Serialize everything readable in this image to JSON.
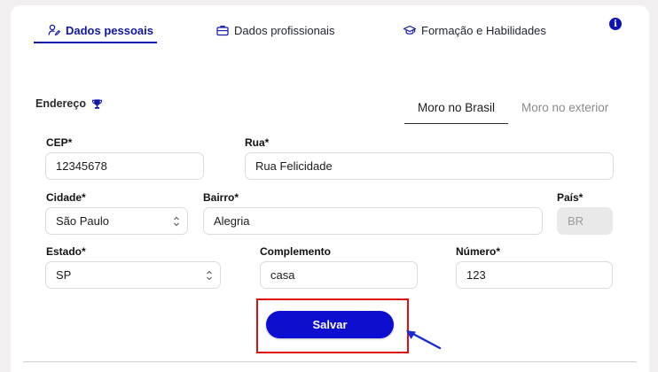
{
  "tabs": [
    {
      "label": "Dados pessoais",
      "icon": "person-edit-icon",
      "active": true
    },
    {
      "label": "Dados profissionais",
      "icon": "briefcase-icon",
      "active": false
    },
    {
      "label": "Formação e Habilidades",
      "icon": "graduation-cap-icon",
      "active": false
    }
  ],
  "section": {
    "title": "Endereço",
    "icon": "trophy-icon"
  },
  "location_tabs": [
    {
      "label": "Moro no Brasil",
      "active": true
    },
    {
      "label": "Moro no exterior",
      "active": false
    }
  ],
  "form": {
    "cep": {
      "label": "CEP*",
      "value": "12345678"
    },
    "rua": {
      "label": "Rua*",
      "value": "Rua Felicidade"
    },
    "cidade": {
      "label": "Cidade*",
      "value": "São Paulo"
    },
    "bairro": {
      "label": "Bairro*",
      "value": "Alegria"
    },
    "pais": {
      "label": "País*",
      "value": "BR"
    },
    "estado": {
      "label": "Estado*",
      "value": "SP"
    },
    "complemento": {
      "label": "Complemento",
      "value": "casa"
    },
    "numero": {
      "label": "Número*",
      "value": "123"
    }
  },
  "save_button": {
    "label": "Salvar"
  },
  "colors": {
    "accent": "#1016a8",
    "button": "#0d0ecf",
    "highlight": "#e01010",
    "background": "#f1efef"
  }
}
